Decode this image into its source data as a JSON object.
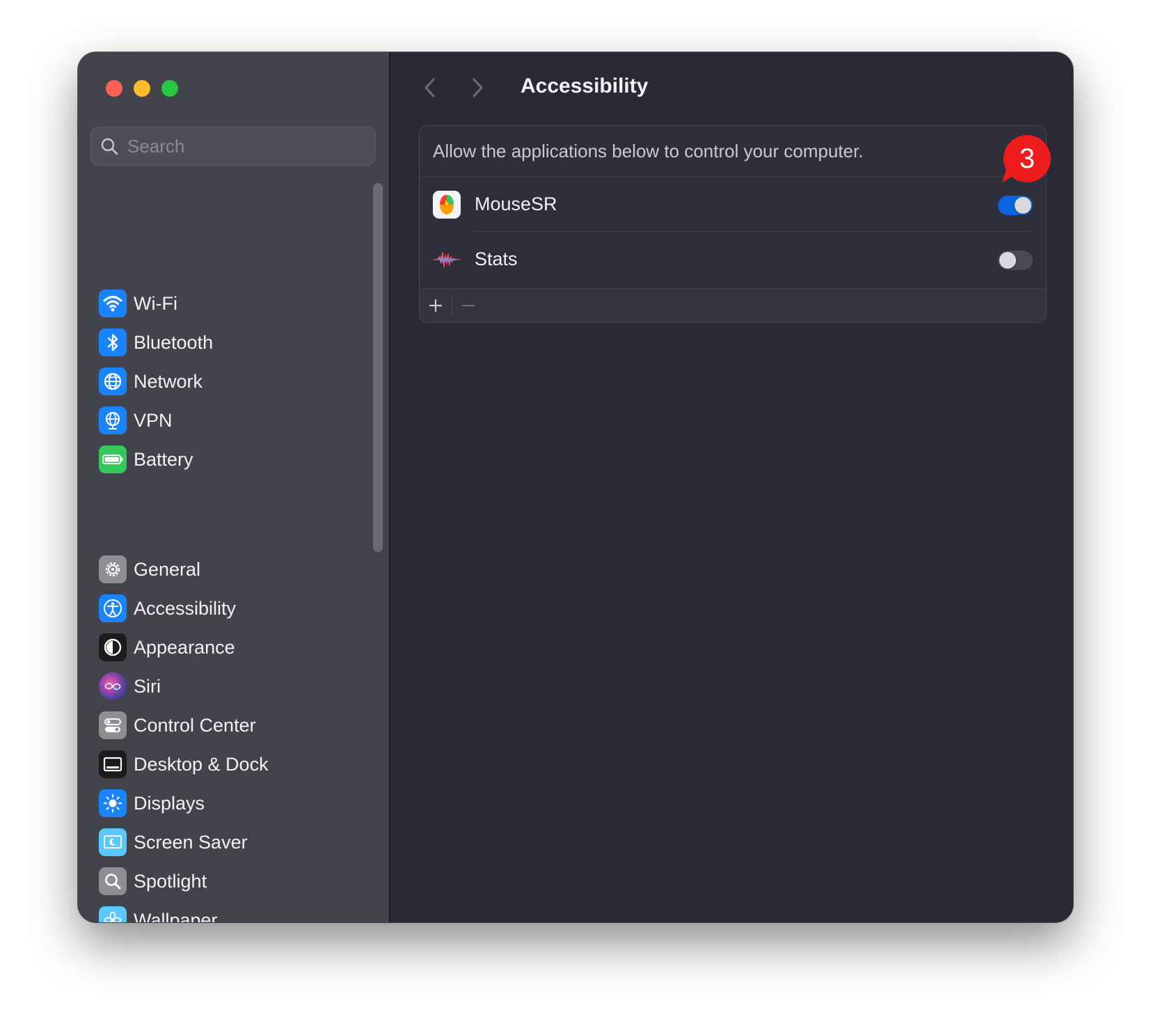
{
  "window": {
    "traffic_lights": [
      "close",
      "minimize",
      "zoom"
    ]
  },
  "search": {
    "placeholder": "Search",
    "value": ""
  },
  "sidebar": {
    "groups": [
      [
        {
          "label": "Wi-Fi",
          "icon": "wifi-icon",
          "color": "#1a84ff"
        },
        {
          "label": "Bluetooth",
          "icon": "bluetooth-icon",
          "color": "#1a84ff"
        },
        {
          "label": "Network",
          "icon": "globe-icon",
          "color": "#1a84ff"
        },
        {
          "label": "VPN",
          "icon": "vpn-globe-icon",
          "color": "#1a84ff"
        },
        {
          "label": "Battery",
          "icon": "battery-icon",
          "color": "#34c759"
        }
      ],
      [
        {
          "label": "General",
          "icon": "gear-icon",
          "color": "#8e8e93"
        },
        {
          "label": "Accessibility",
          "icon": "accessibility-icon",
          "color": "#1a84ff"
        },
        {
          "label": "Appearance",
          "icon": "appearance-icon",
          "color": "#1c1c1e"
        },
        {
          "label": "Siri",
          "icon": "siri-icon",
          "color": "#8e44ad"
        },
        {
          "label": "Control Center",
          "icon": "control-center-icon",
          "color": "#8e8e93"
        },
        {
          "label": "Desktop & Dock",
          "icon": "dock-icon",
          "color": "#1c1c1e"
        },
        {
          "label": "Displays",
          "icon": "displays-icon",
          "color": "#1a84ff"
        },
        {
          "label": "Screen Saver",
          "icon": "screen-saver-icon",
          "color": "#5ac8fa"
        },
        {
          "label": "Spotlight",
          "icon": "spotlight-icon",
          "color": "#8e8e93"
        },
        {
          "label": "Wallpaper",
          "icon": "wallpaper-icon",
          "color": "#5ac8fa"
        }
      ]
    ]
  },
  "main": {
    "title": "Accessibility",
    "description": "Allow the applications below to control your computer.",
    "apps": [
      {
        "name": "MouseSR",
        "icon": "mousesr-app-icon",
        "enabled": true
      },
      {
        "name": "Stats",
        "icon": "stats-app-icon",
        "enabled": false
      }
    ],
    "footer": {
      "add": "+",
      "remove": "−"
    }
  },
  "annotation": {
    "badge_label": "3",
    "color": "#ee1c1c"
  },
  "colors": {
    "toggle_on": "#0a64e0",
    "sidebar_bg": "#43434c",
    "main_bg": "#2a2a36"
  }
}
